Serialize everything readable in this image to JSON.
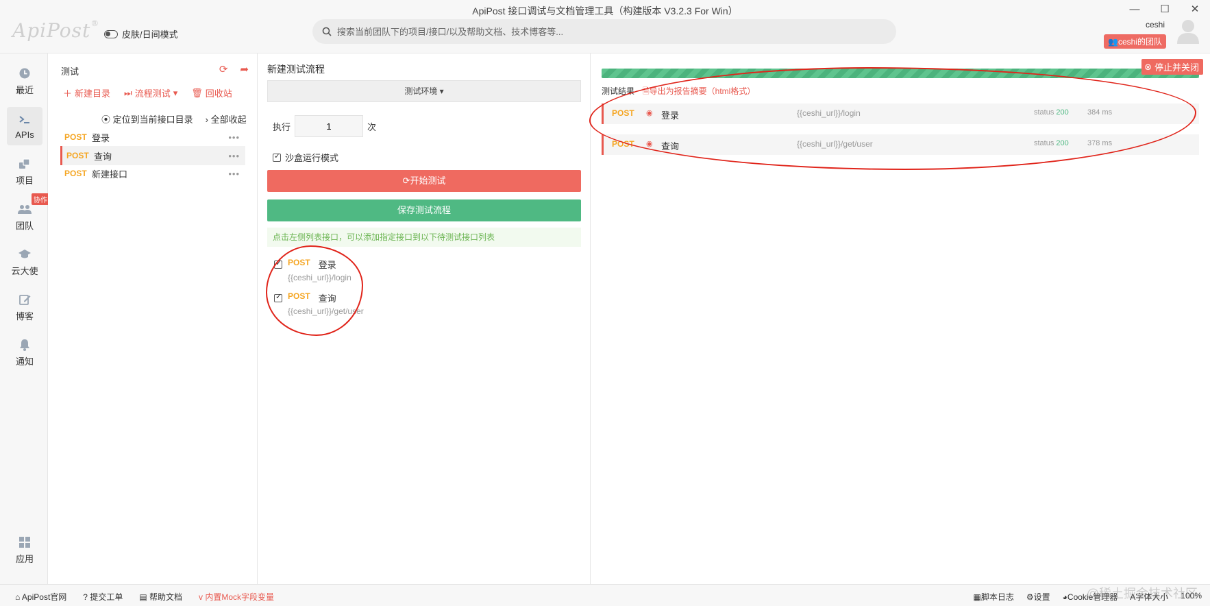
{
  "app": {
    "window_title": "ApiPost 接口调试与文档管理工具（构建版本 V3.2.3 For Win）",
    "logo": "ApiPost",
    "logo_mark": "®",
    "skin_toggle": "皮肤/日间模式",
    "search_placeholder": "搜索当前团队下的项目/接口/以及帮助文档、技术博客等...",
    "user": "ceshi",
    "team": "ceshi的团队",
    "window_controls": [
      "—",
      "☐",
      "✕"
    ]
  },
  "nav": {
    "items": [
      {
        "label": "最近",
        "icon": "clock-icon"
      },
      {
        "label": "APIs",
        "icon": "terminal-icon"
      },
      {
        "label": "项目",
        "icon": "project-icon"
      },
      {
        "label": "团队",
        "icon": "team-icon",
        "badge": "协作"
      },
      {
        "label": "云大使",
        "icon": "graduation-cap-icon"
      },
      {
        "label": "博客",
        "icon": "edit-icon"
      },
      {
        "label": "通知",
        "icon": "bell-icon"
      },
      {
        "label": "应用",
        "icon": "apps-grid-icon"
      }
    ]
  },
  "tree": {
    "title": "测试",
    "new_dir": "新建目录",
    "flow_test": "流程测试",
    "recycle": "回收站",
    "locate": "定位到当前接口目录",
    "collapse": "全部收起",
    "apis": [
      {
        "method": "POST",
        "name": "登录"
      },
      {
        "method": "POST",
        "name": "查询",
        "active": true
      },
      {
        "method": "POST",
        "name": "新建接口"
      }
    ],
    "more": "•••"
  },
  "flow": {
    "title": "新建测试流程",
    "env": "测试环境 ▾",
    "exec_label": "执行",
    "exec_value": "1",
    "exec_unit": "次",
    "sandbox": "沙盒运行模式",
    "start": "开始测试",
    "save": "保存测试流程",
    "hint": "点击左侧列表接口，可以添加指定接口到以下待测试接口列表",
    "items": [
      {
        "method": "POST",
        "name": "登录",
        "url": "{{ceshi_url}}/login"
      },
      {
        "method": "POST",
        "name": "查询",
        "url": "{{ceshi_url}}/get/user"
      }
    ]
  },
  "result": {
    "stop": "停止并关闭",
    "heading": "测试结果",
    "export": "导出为报告摘要（html格式）",
    "progress": 1.0,
    "rows": [
      {
        "method": "POST",
        "name": "登录",
        "url": "{{ceshi_url}}/login",
        "status_label": "status",
        "status": "200",
        "time": "384 ms"
      },
      {
        "method": "POST",
        "name": "查询",
        "url": "{{ceshi_url}}/get/user",
        "status_label": "status",
        "status": "200",
        "time": "378 ms"
      }
    ]
  },
  "statusbar": {
    "official": "ApiPost官网",
    "ticket": "提交工单",
    "help": "帮助文档",
    "mock": "内置Mock字段变量",
    "script_log": "脚本日志",
    "settings": "设置",
    "cookie": "Cookie管理器",
    "font_size": "字体大小",
    "zoom": "100%"
  },
  "watermark": "@稀土掘金技术社区",
  "colors": {
    "accent_red": "#e8594f",
    "success_green": "#4fb983",
    "method_orange": "#f5a623",
    "annotation_red": "#e0241a"
  }
}
